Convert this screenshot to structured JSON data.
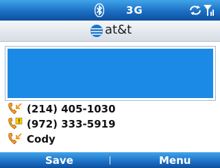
{
  "status": {
    "bluetooth_icon": "bluetooth-icon",
    "network": "3G",
    "connection_icon": "data-connection-icon",
    "signal_icon": "signal-strength-icon"
  },
  "brand": {
    "logo_icon": "att-globe-icon",
    "name": "at&t"
  },
  "input": {
    "value": ""
  },
  "list": [
    {
      "icon": "incoming-call-icon",
      "label": "(214) 405-1030"
    },
    {
      "icon": "missed-call-icon",
      "label": "(972) 333-5919"
    },
    {
      "icon": "incoming-call-icon",
      "label": "Cody"
    }
  ],
  "softkeys": {
    "left": "Save",
    "right": "Menu"
  },
  "colors": {
    "bar_blue": "#1c6fc4",
    "input_blue": "#1b8ae6",
    "phone_orange": "#f39a1e",
    "missed_badge_yellow": "#f4d10c"
  }
}
